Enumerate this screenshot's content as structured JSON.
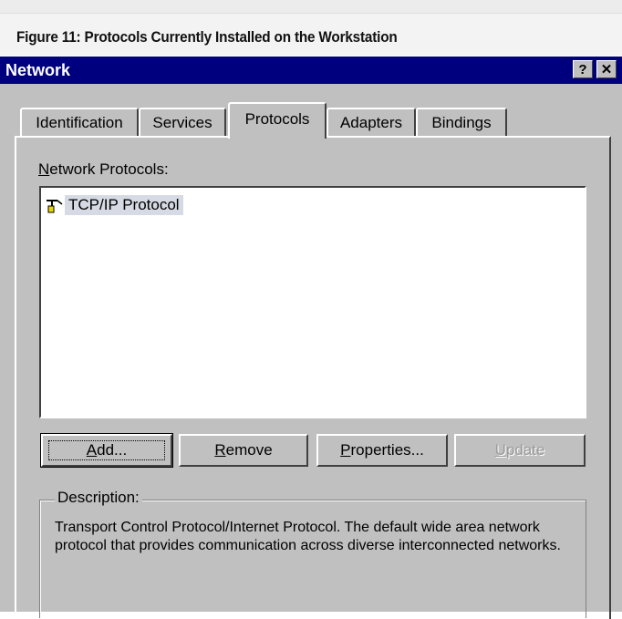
{
  "caption": "Figure 11: Protocols Currently Installed on the Workstation",
  "window": {
    "title": "Network",
    "help_label": "?",
    "close_label": "✕"
  },
  "tabs": [
    {
      "label": "Identification",
      "active": false
    },
    {
      "label": "Services",
      "active": false
    },
    {
      "label": "Protocols",
      "active": true
    },
    {
      "label": "Adapters",
      "active": false
    },
    {
      "label": "Bindings",
      "active": false
    }
  ],
  "protocols": {
    "label_first": "N",
    "label_rest": "etwork Protocols:",
    "items": [
      {
        "label": "TCP/IP Protocol",
        "icon": "network-protocol-icon",
        "selected": true
      }
    ]
  },
  "buttons": {
    "add": {
      "first": "A",
      "rest": "dd..."
    },
    "remove": {
      "first": "R",
      "rest": "emove"
    },
    "properties": {
      "first": "P",
      "rest": "roperties..."
    },
    "update": {
      "first": "U",
      "rest": "pdate",
      "disabled": true
    }
  },
  "description": {
    "title": "Description:",
    "text": "Transport Control Protocol/Internet Protocol. The default wide area network protocol that provides communication across diverse interconnected networks."
  },
  "colors": {
    "titlebar": "#00007e",
    "face": "#c0c0c0",
    "selection": "#d6dae4"
  }
}
